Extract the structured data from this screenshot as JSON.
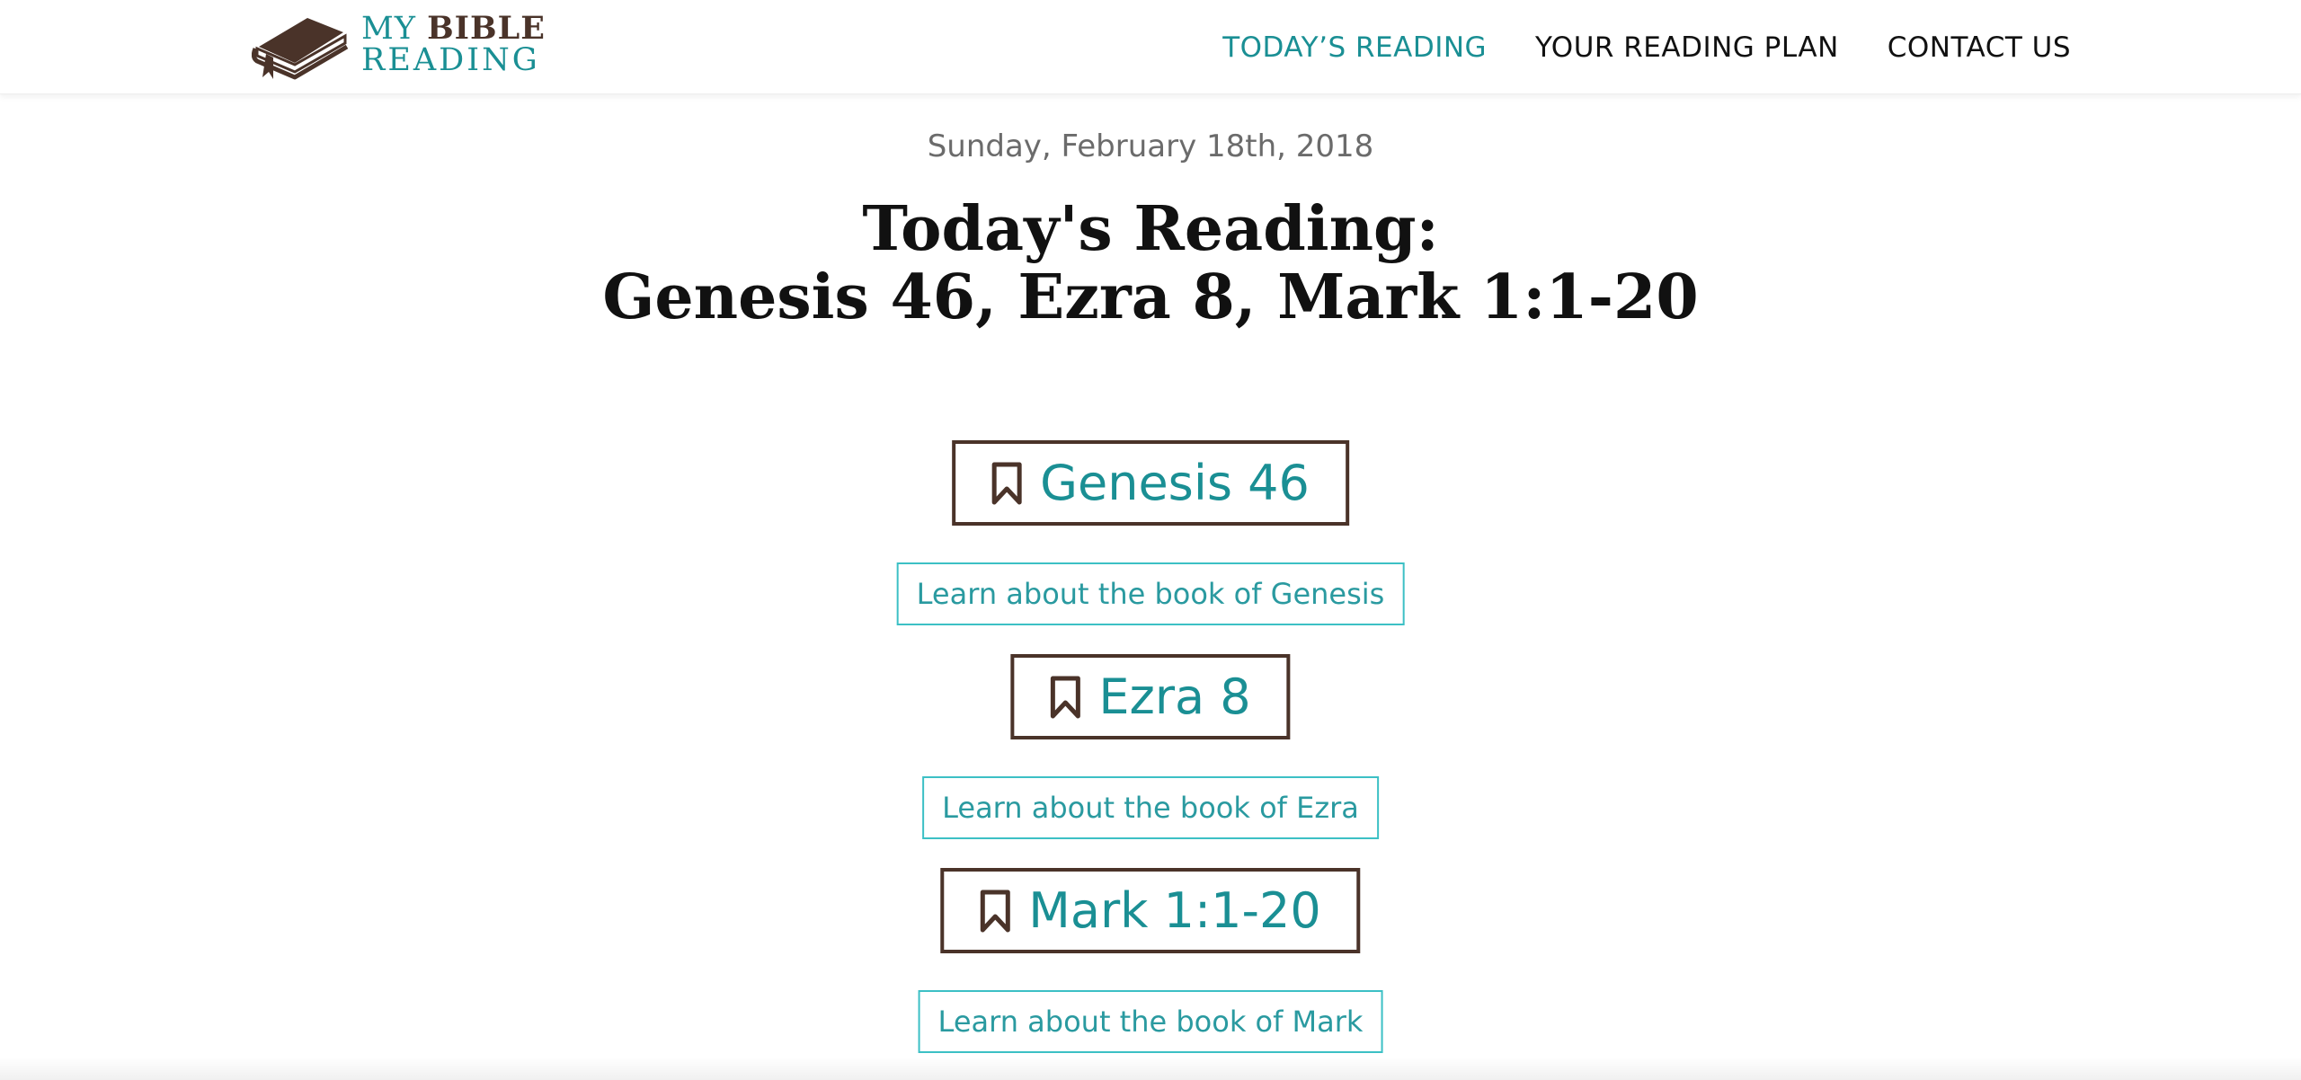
{
  "header": {
    "logo": {
      "line1_my": "MY",
      "line1_bible": "BIBLE",
      "line2": "READING"
    },
    "nav": [
      {
        "label": "TODAY’S READING",
        "active": true
      },
      {
        "label": "YOUR READING PLAN",
        "active": false
      },
      {
        "label": "CONTACT US",
        "active": false
      }
    ]
  },
  "main": {
    "date": "Sunday, February 18th, 2018",
    "title_line1": "Today's Reading:",
    "title_line2": "Genesis 46, Ezra 8, Mark 1:1-20",
    "readings": [
      {
        "chapter": "Genesis 46",
        "learn": "Learn about the book of Genesis",
        "icon": "bookmark-icon"
      },
      {
        "chapter": "Ezra 8",
        "learn": "Learn about the book of Ezra",
        "icon": "bookmark-icon"
      },
      {
        "chapter": "Mark 1:1-20",
        "learn": "Learn about the book of Mark",
        "icon": "bookmark-icon"
      }
    ]
  },
  "colors": {
    "accent": "#1a8f94",
    "brown": "#4a3329",
    "learn_border": "#3cc0c5",
    "date_text": "#6b6b6b"
  }
}
